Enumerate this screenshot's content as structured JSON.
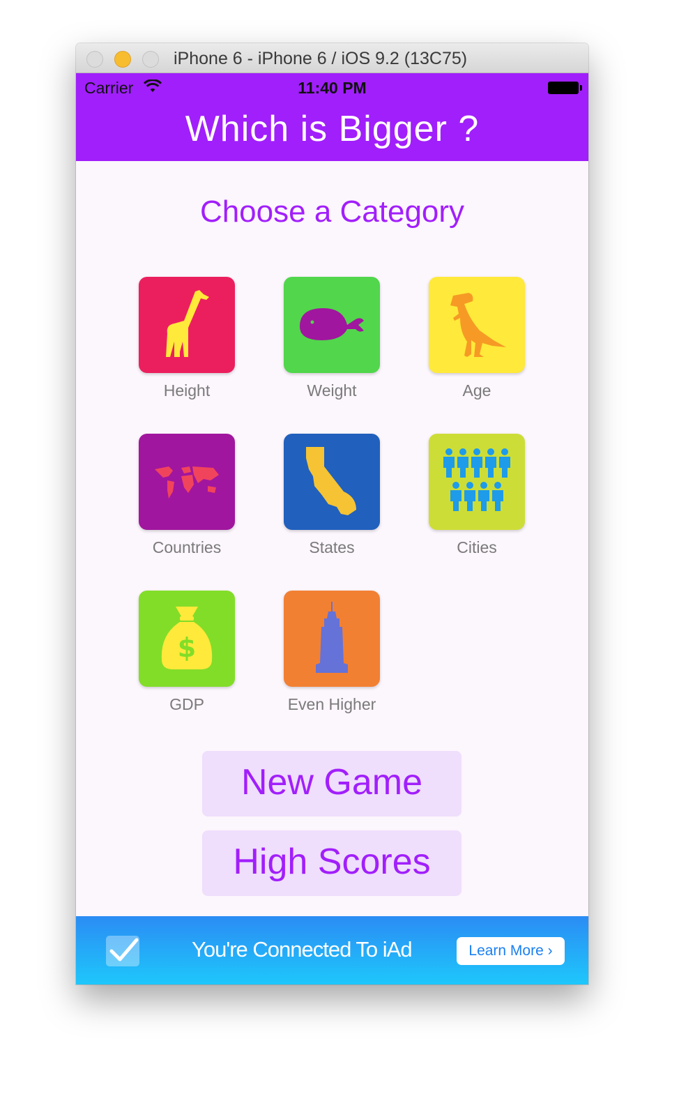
{
  "window": {
    "title": "iPhone 6 - iPhone 6 / iOS 9.2 (13C75)"
  },
  "status_bar": {
    "carrier": "Carrier",
    "time": "11:40 PM"
  },
  "nav": {
    "title": "Which is Bigger ?"
  },
  "heading": "Choose a Category",
  "categories": [
    {
      "label": "Height",
      "icon": "giraffe-icon",
      "color": "#ec1f5e"
    },
    {
      "label": "Weight",
      "icon": "whale-icon",
      "color": "#51d64c"
    },
    {
      "label": "Age",
      "icon": "dinosaur-icon",
      "color": "#ffe93a"
    },
    {
      "label": "Countries",
      "icon": "world-map-icon",
      "color": "#a1169e"
    },
    {
      "label": "States",
      "icon": "california-icon",
      "color": "#2160bd"
    },
    {
      "label": "Cities",
      "icon": "people-crowd-icon",
      "color": "#cddd37"
    },
    {
      "label": "GDP",
      "icon": "money-bag-icon",
      "color": "#82dd28"
    },
    {
      "label": "Even Higher",
      "icon": "skyscraper-icon",
      "color": "#f28033"
    }
  ],
  "buttons": {
    "new_game": "New Game",
    "high_scores": "High Scores"
  },
  "ad": {
    "text": "You're Connected To iAd",
    "learn_more": "Learn More ›"
  },
  "colors": {
    "accent": "#a11ffb",
    "button_bg": "#efdefc"
  }
}
